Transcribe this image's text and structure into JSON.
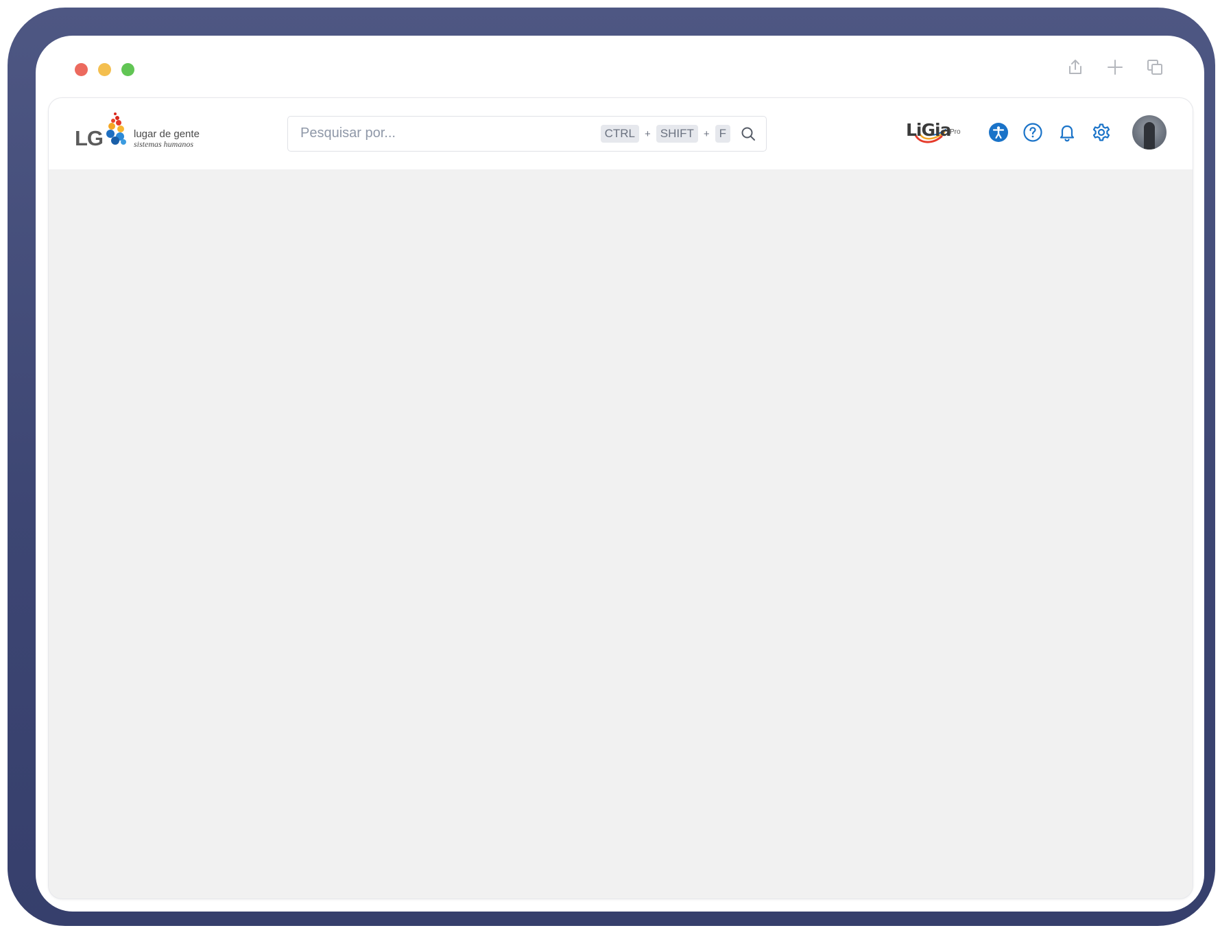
{
  "window": {
    "controls": [
      "close",
      "minimize",
      "maximize"
    ],
    "actions": [
      {
        "icon": "share-icon"
      },
      {
        "icon": "plus-icon"
      },
      {
        "icon": "copy-window-icon"
      }
    ]
  },
  "header": {
    "logo": {
      "mark": "LG",
      "name": "lugar de gente",
      "tagline": "sistemas humanos"
    },
    "search": {
      "placeholder": "Pesquisar por...",
      "value": "",
      "shortcut": {
        "key1": "CTRL",
        "key2": "SHIFT",
        "key3": "F",
        "separator": "+"
      }
    },
    "ligia": {
      "word": "LiGia",
      "suffix": "Pro"
    },
    "tools": [
      {
        "icon": "accessibility-icon"
      },
      {
        "icon": "help-icon"
      },
      {
        "icon": "bell-icon"
      },
      {
        "icon": "gear-icon"
      }
    ],
    "accent_color": "#1a73c8"
  },
  "main": {
    "background": "#f1f1f1"
  }
}
